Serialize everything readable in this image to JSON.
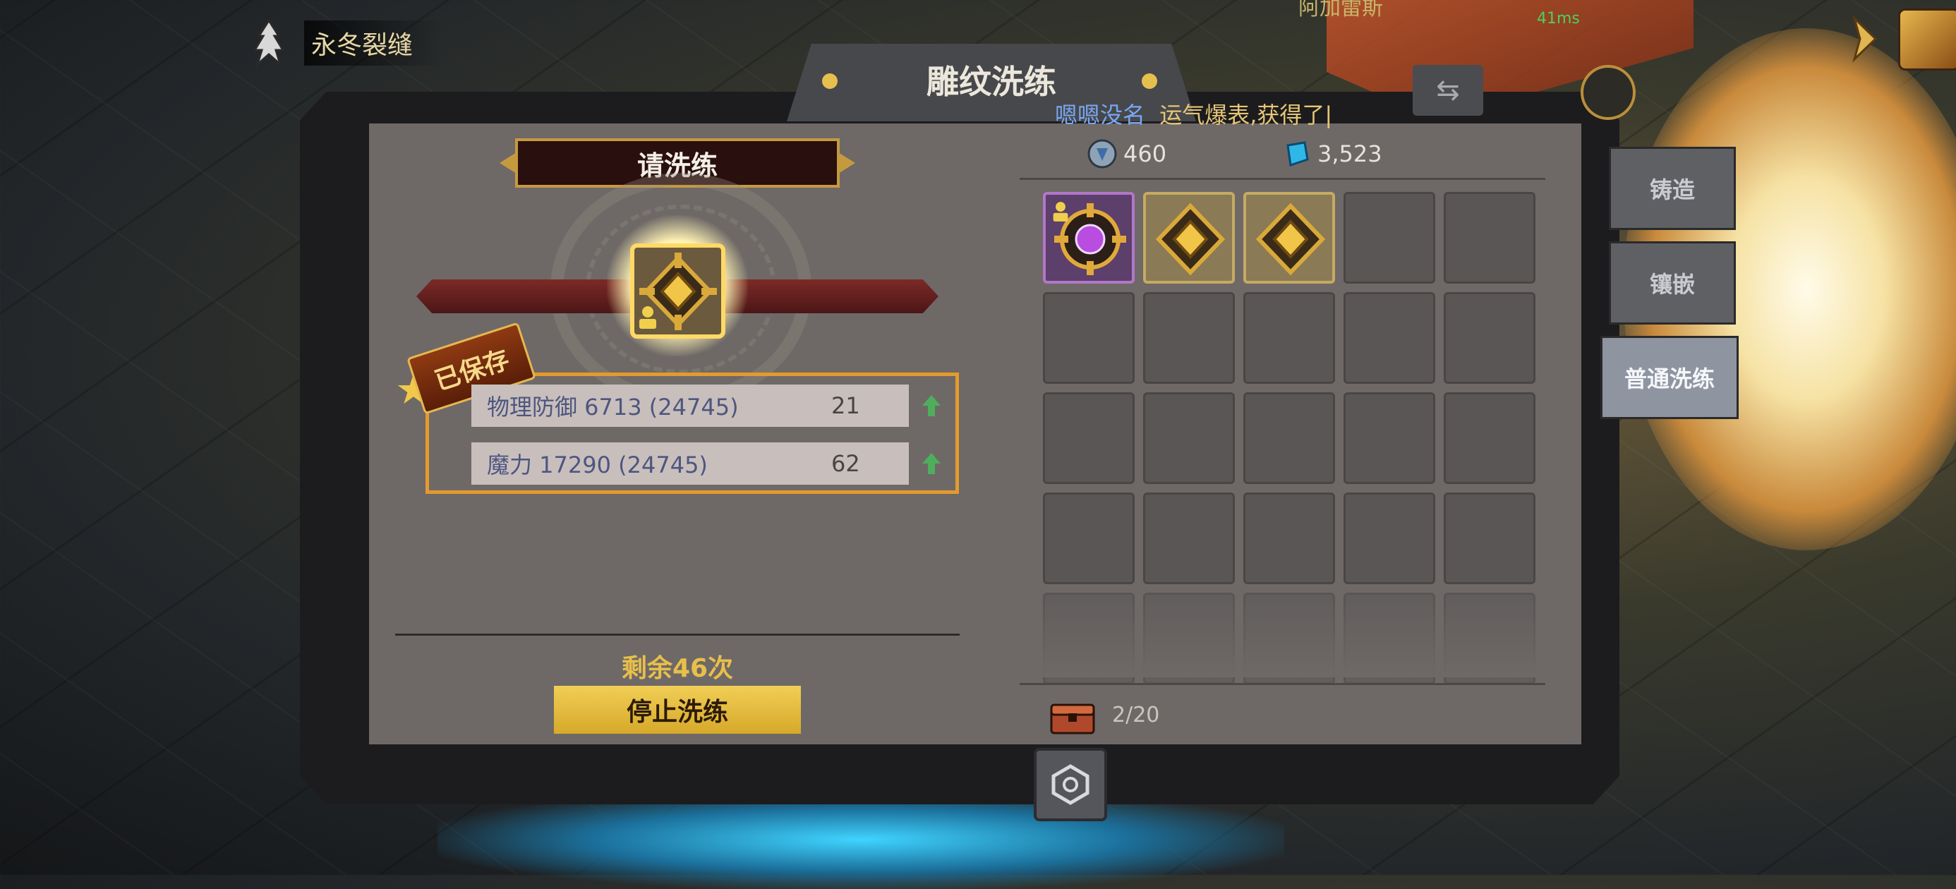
{
  "location": {
    "name": "永冬裂缝"
  },
  "top": {
    "player_name": "阿加雷斯",
    "ping": "41ms"
  },
  "window": {
    "title": "雕纹洗练"
  },
  "chat": {
    "sender": "嗯嗯没名",
    "message": "运气爆表,获得了|"
  },
  "left": {
    "prompt": "请洗练",
    "saved_badge": "已保存",
    "attributes": [
      {
        "name": "物理防御 6713 (24745)",
        "value": "21",
        "trend": "up"
      },
      {
        "name": "魔力 17290 (24745)",
        "value": "62",
        "trend": "up"
      }
    ],
    "remaining": "剩余46次",
    "stop_button": "停止洗练"
  },
  "currency": [
    {
      "icon": "rune-coin-icon",
      "value": "460"
    },
    {
      "icon": "blue-crystal-icon",
      "value": "3,523"
    }
  ],
  "inventory": {
    "items": [
      {
        "type": "purple-gem-rune",
        "locked": true
      },
      {
        "type": "gold-rune",
        "locked": false
      },
      {
        "type": "gold-rune",
        "locked": false
      }
    ],
    "capacity_text": "2/20"
  },
  "side_tabs": [
    {
      "label": "铸造",
      "active": false
    },
    {
      "label": "镶嵌",
      "active": false
    },
    {
      "label": "普通洗练",
      "active": true
    }
  ],
  "colors": {
    "accent_gold": "#e6c04f",
    "frame_orange": "#e59a2e",
    "panel_bg": "#6e6967"
  }
}
